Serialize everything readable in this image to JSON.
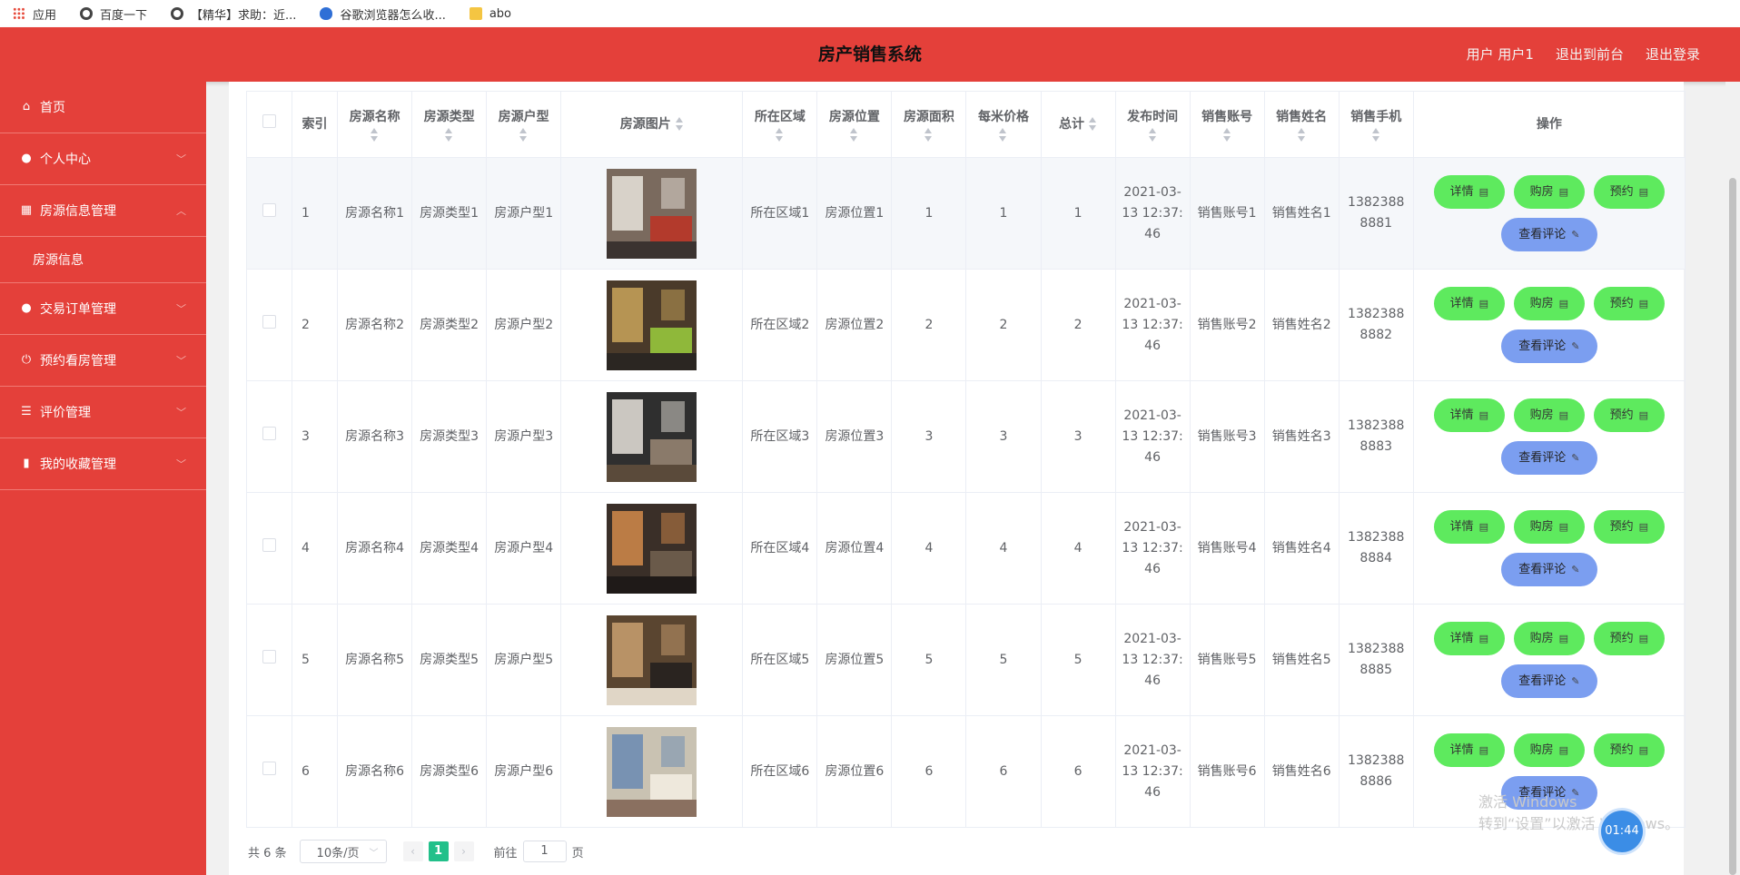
{
  "bookmarks": [
    {
      "label": "应用",
      "icon": "apps-grid-icon"
    },
    {
      "label": "百度一下",
      "icon": "globe-icon"
    },
    {
      "label": "【精华】求助：近...",
      "icon": "globe-icon"
    },
    {
      "label": "谷歌浏览器怎么收...",
      "icon": "baidu-paw-icon"
    },
    {
      "label": "abo",
      "icon": "folder-icon"
    }
  ],
  "header": {
    "title": "房产销售系统",
    "user": "用户 用户1",
    "back_front": "退出到前台",
    "logout": "退出登录"
  },
  "sidebar": {
    "items": [
      {
        "label": "首页",
        "icon": "home-icon"
      },
      {
        "label": "个人中心",
        "icon": "user-icon"
      },
      {
        "label": "房源信息管理",
        "icon": "building-icon"
      },
      {
        "label": "房源信息",
        "icon": ""
      },
      {
        "label": "交易订单管理",
        "icon": "user-icon"
      },
      {
        "label": "预约看房管理",
        "icon": "power-icon"
      },
      {
        "label": "评价管理",
        "icon": "list-icon"
      },
      {
        "label": "我的收藏管理",
        "icon": "book-icon"
      }
    ]
  },
  "table": {
    "headers": [
      "索引",
      "房源名称",
      "房源类型",
      "房源户型",
      "房源图片",
      "所在区域",
      "房源位置",
      "房源面积",
      "每米价格",
      "总计",
      "发布时间",
      "销售账号",
      "销售姓名",
      "销售手机",
      "操作"
    ],
    "rows": [
      {
        "idx": "1",
        "name": "房源名称1",
        "type": "房源类型1",
        "layout": "房源户型1",
        "area": "所在区域1",
        "location": "房源位置1",
        "size": "1",
        "price": "1",
        "total": "1",
        "time": "2021-03-13 12:37:46",
        "account": "销售账号1",
        "seller": "销售姓名1",
        "phone": "13823888881"
      },
      {
        "idx": "2",
        "name": "房源名称2",
        "type": "房源类型2",
        "layout": "房源户型2",
        "area": "所在区域2",
        "location": "房源位置2",
        "size": "2",
        "price": "2",
        "total": "2",
        "time": "2021-03-13 12:37:46",
        "account": "销售账号2",
        "seller": "销售姓名2",
        "phone": "13823888882"
      },
      {
        "idx": "3",
        "name": "房源名称3",
        "type": "房源类型3",
        "layout": "房源户型3",
        "area": "所在区域3",
        "location": "房源位置3",
        "size": "3",
        "price": "3",
        "total": "3",
        "time": "2021-03-13 12:37:46",
        "account": "销售账号3",
        "seller": "销售姓名3",
        "phone": "13823888883"
      },
      {
        "idx": "4",
        "name": "房源名称4",
        "type": "房源类型4",
        "layout": "房源户型4",
        "area": "所在区域4",
        "location": "房源位置4",
        "size": "4",
        "price": "4",
        "total": "4",
        "time": "2021-03-13 12:37:46",
        "account": "销售账号4",
        "seller": "销售姓名4",
        "phone": "13823888884"
      },
      {
        "idx": "5",
        "name": "房源名称5",
        "type": "房源类型5",
        "layout": "房源户型5",
        "area": "所在区域5",
        "location": "房源位置5",
        "size": "5",
        "price": "5",
        "total": "5",
        "time": "2021-03-13 12:37:46",
        "account": "销售账号5",
        "seller": "销售姓名5",
        "phone": "13823888885"
      },
      {
        "idx": "6",
        "name": "房源名称6",
        "type": "房源类型6",
        "layout": "房源户型6",
        "area": "所在区域6",
        "location": "房源位置6",
        "size": "6",
        "price": "6",
        "total": "6",
        "time": "2021-03-13 12:37:46",
        "account": "销售账号6",
        "seller": "销售姓名6",
        "phone": "13823888886"
      }
    ],
    "actions": {
      "detail": "详情",
      "buy": "购房",
      "reserve": "预约",
      "review": "查看评论"
    }
  },
  "pagination": {
    "total": "共 6 条",
    "page_size": "10条/页",
    "current": "1",
    "goto_label": "前往",
    "goto_value": "1",
    "page_suffix": "页"
  },
  "overlay": {
    "watermark_line1": "激活 Windows",
    "watermark_line2": "转到“设置”以激活 Windows。",
    "clock": "01:44"
  },
  "colors": {
    "brand_red": "#e4403a",
    "action_green": "#5eea5e",
    "action_blue": "#7b9ef0",
    "pager_active": "#22c08a"
  }
}
